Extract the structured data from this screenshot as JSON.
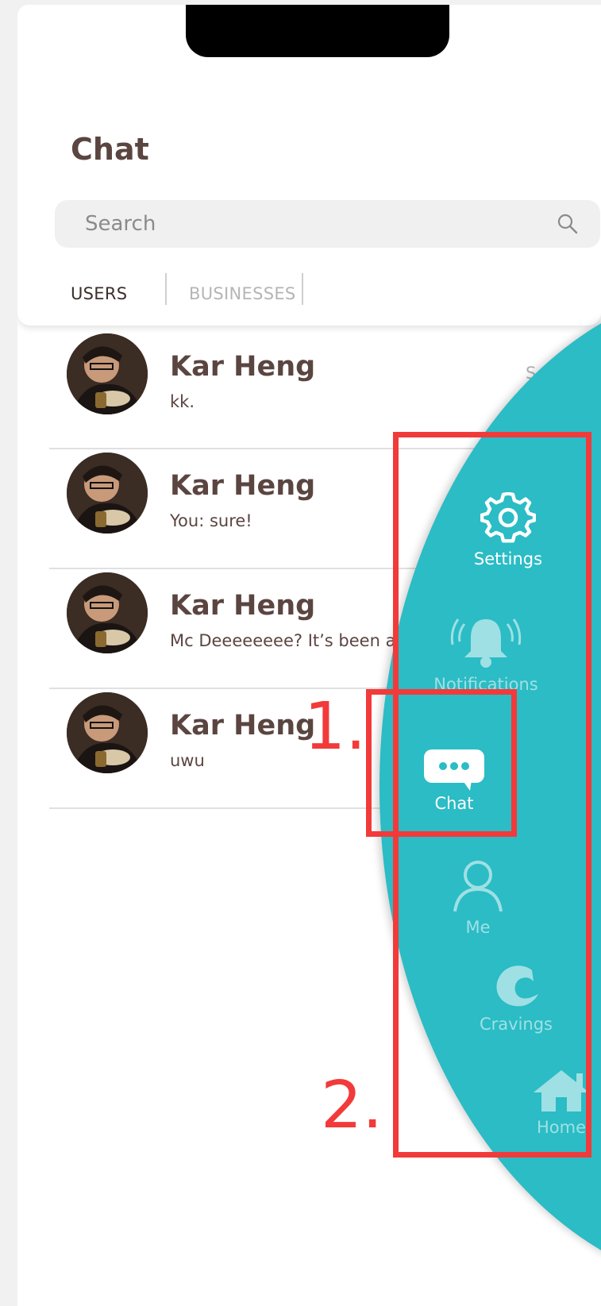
{
  "header": {
    "title": "Chat",
    "search": {
      "placeholder": "Search",
      "value": ""
    },
    "tabs": [
      {
        "label": "USERS",
        "selected": true
      },
      {
        "label": "BUSINESSES",
        "selected": false
      }
    ]
  },
  "conversations": [
    {
      "name": "Kar Heng",
      "last_message": "kk.",
      "time": "S"
    },
    {
      "name": "Kar Heng",
      "last_message": "You: sure!"
    },
    {
      "name": "Kar Heng",
      "last_message": "Mc Deeeeeeee? It’s been a"
    },
    {
      "name": "Kar Heng",
      "last_message": "uwu"
    }
  ],
  "side_menu": {
    "color": "#2bbcc5",
    "items": [
      {
        "label": "Settings",
        "icon": "gear-icon"
      },
      {
        "label": "Notifications",
        "icon": "bell-icon"
      },
      {
        "label": "Chat",
        "icon": "chat-bubble-icon",
        "active": true
      },
      {
        "label": "Me",
        "icon": "user-icon"
      },
      {
        "label": "Cravings",
        "icon": "cravings-logo-icon"
      },
      {
        "label": "Home",
        "icon": "home-icon"
      }
    ]
  },
  "annotations": {
    "color": "#f23a3a",
    "labels": [
      "1.",
      "2."
    ]
  }
}
